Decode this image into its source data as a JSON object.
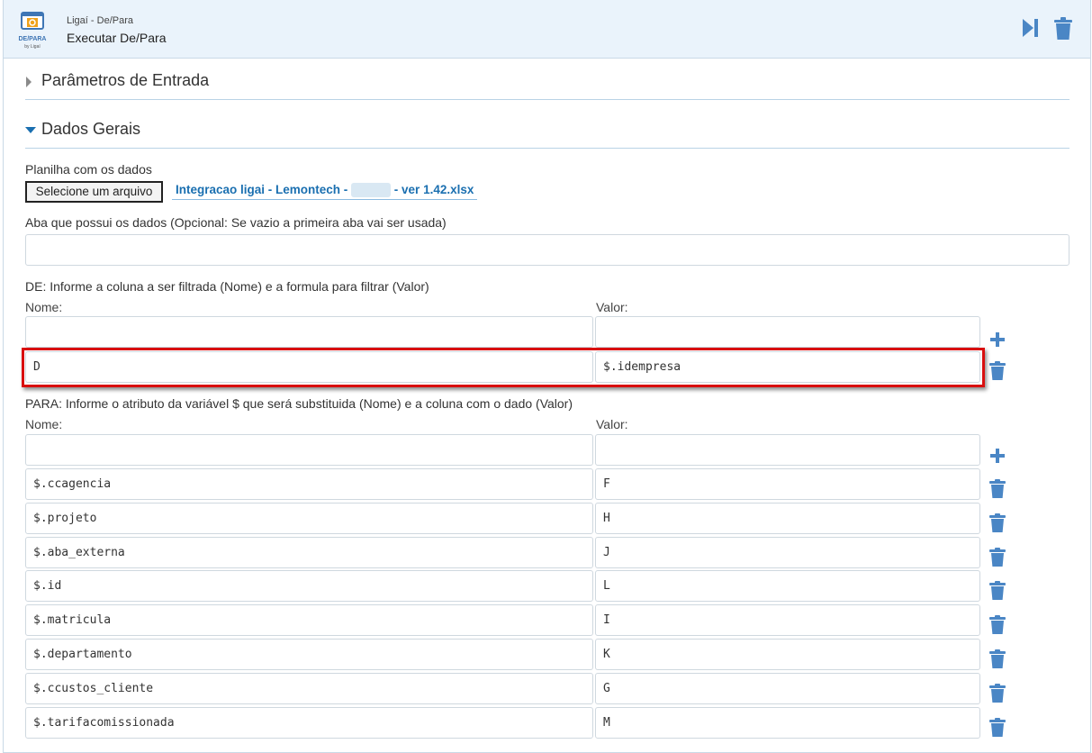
{
  "header": {
    "logo_text": "DE/PARA",
    "logo_sub": "by Ligaí",
    "app_name": "Ligaí - De/Para",
    "title": "Executar De/Para",
    "actions": [
      {
        "name": "run-step-icon"
      },
      {
        "name": "trash-icon"
      }
    ]
  },
  "sections": {
    "params": {
      "title": "Parâmetros de Entrada",
      "expanded": false
    },
    "general": {
      "title": "Dados Gerais",
      "expanded": true
    }
  },
  "spreadsheet": {
    "label": "Planilha com os dados",
    "button_label": "Selecione um arquivo",
    "file_name_prefix": "Integracao ligai - Lemontech - ",
    "file_name_suffix": " - ver 1.42.xlsx"
  },
  "sheet_tab": {
    "label": "Aba que possui os dados (Opcional: Se vazio a primeira aba vai ser usada)",
    "value": ""
  },
  "de": {
    "label": "DE: Informe a coluna a ser filtrada (Nome) e a formula para filtrar (Valor)",
    "name_header": "Nome:",
    "value_header": "Valor:",
    "new_row": {
      "name": "",
      "value": ""
    },
    "rows": [
      {
        "name": "D",
        "value": "$.idempresa"
      }
    ]
  },
  "para": {
    "label": "PARA: Informe o atributo da variável $ que será substituida (Nome) e a coluna com o dado (Valor)",
    "name_header": "Nome:",
    "value_header": "Valor:",
    "new_row": {
      "name": "",
      "value": ""
    },
    "rows": [
      {
        "name": "$.ccagencia",
        "value": "F"
      },
      {
        "name": "$.projeto",
        "value": "H"
      },
      {
        "name": "$.aba_externa",
        "value": "J"
      },
      {
        "name": "$.id",
        "value": "L"
      },
      {
        "name": "$.matricula",
        "value": "I"
      },
      {
        "name": "$.departamento",
        "value": "K"
      },
      {
        "name": "$.ccustos_cliente",
        "value": "G"
      },
      {
        "name": "$.tarifacomissionada",
        "value": "M"
      }
    ]
  },
  "colors": {
    "accent": "#1a6fb0",
    "icon_blue": "#4a86c5",
    "header_bg": "#eaf3fb",
    "highlight": "#d90f0f"
  }
}
